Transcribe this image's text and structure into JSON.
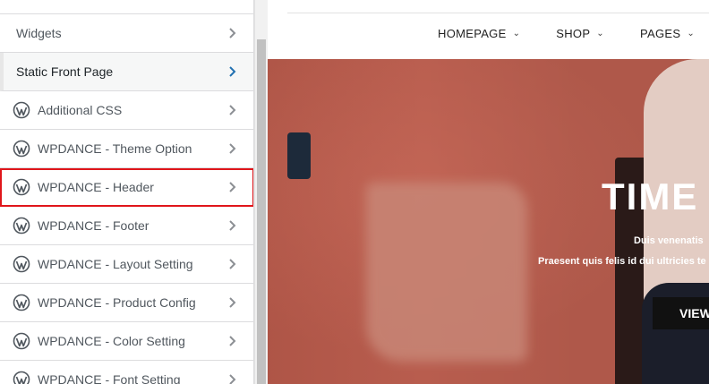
{
  "sidebar": {
    "items": [
      {
        "label": "",
        "icon": false
      },
      {
        "label": "Widgets",
        "icon": false
      },
      {
        "label": "Static Front Page",
        "icon": false
      },
      {
        "label": "Additional CSS",
        "icon": "wordpress-icon"
      },
      {
        "label": "WPDANCE - Theme Option",
        "icon": "wordpress-icon"
      },
      {
        "label": "WPDANCE - Header",
        "icon": "wordpress-icon"
      },
      {
        "label": "WPDANCE - Footer",
        "icon": "wordpress-icon"
      },
      {
        "label": "WPDANCE - Layout Setting",
        "icon": "wordpress-icon"
      },
      {
        "label": "WPDANCE - Product Config",
        "icon": "wordpress-icon"
      },
      {
        "label": "WPDANCE - Color Setting",
        "icon": "wordpress-icon"
      },
      {
        "label": "WPDANCE - Font Setting",
        "icon": "wordpress-icon"
      }
    ]
  },
  "preview": {
    "nav": [
      {
        "label": "HOMEPAGE"
      },
      {
        "label": "SHOP"
      },
      {
        "label": "PAGES"
      }
    ],
    "hero": {
      "title": "TIME T",
      "subtitle": "Duis venenatis",
      "text": "Praesent quis felis id dui ultricies te",
      "button": "VIEW"
    }
  },
  "colors": {
    "highlight_border": "#e0161b",
    "hero_background": "#b85d4e",
    "wordpress_icon": "#50575e"
  }
}
